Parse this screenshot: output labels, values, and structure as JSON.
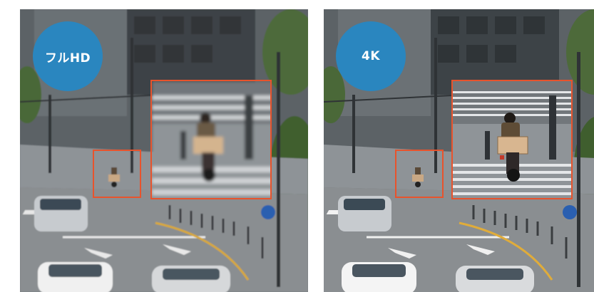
{
  "comparison": {
    "left": {
      "badge_label": "フルHD",
      "quality": "blurry"
    },
    "right": {
      "badge_label": "4K",
      "quality": "sharp"
    }
  },
  "colors": {
    "badge_fill": "#2a86bf",
    "highlight_border": "#e8532c",
    "background": "#ffffff"
  },
  "icons": [
    "zoom-inset-icon"
  ]
}
